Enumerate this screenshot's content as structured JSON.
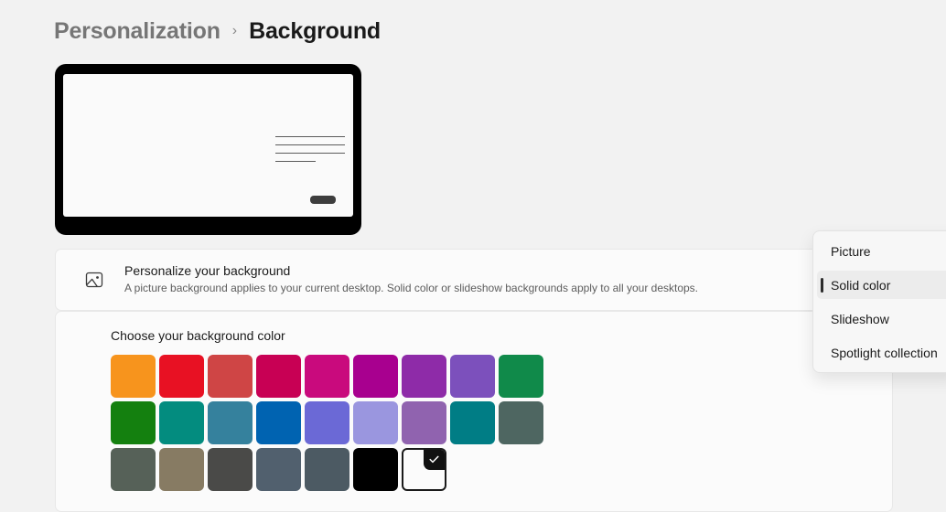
{
  "breadcrumb": {
    "parent": "Personalization",
    "separator": "›",
    "current": "Background"
  },
  "preview": {
    "icon": "monitor-preview",
    "screen_color": "#fafafa",
    "bezel_color": "#000000"
  },
  "personalize_card": {
    "icon": "picture-icon",
    "title": "Personalize your background",
    "subtitle": "A picture background applies to your current desktop. Solid color or slideshow backgrounds apply to all your desktops."
  },
  "colors_card": {
    "label": "Choose your background color",
    "swatches": [
      {
        "name": "orange",
        "hex": "#F7941D"
      },
      {
        "name": "red",
        "hex": "#E81123"
      },
      {
        "name": "muted-red",
        "hex": "#CF4545"
      },
      {
        "name": "crimson",
        "hex": "#C80054"
      },
      {
        "name": "magenta",
        "hex": "#C90A7D"
      },
      {
        "name": "purple-magenta",
        "hex": "#A8008F"
      },
      {
        "name": "purple",
        "hex": "#8E2BA8"
      },
      {
        "name": "light-purple",
        "hex": "#7C50BC"
      },
      {
        "name": "green",
        "hex": "#108A4A"
      },
      {
        "name": "dark-green",
        "hex": "#14800F"
      },
      {
        "name": "teal-green",
        "hex": "#038C7F"
      },
      {
        "name": "steel-blue",
        "hex": "#35819D"
      },
      {
        "name": "blue",
        "hex": "#0063B1"
      },
      {
        "name": "periwinkle",
        "hex": "#6B69D6"
      },
      {
        "name": "light-periwinkle",
        "hex": "#9A96DF"
      },
      {
        "name": "orchid",
        "hex": "#9063AF"
      },
      {
        "name": "teal",
        "hex": "#007D85"
      },
      {
        "name": "slate-green",
        "hex": "#4E6661"
      },
      {
        "name": "gray-green",
        "hex": "#566158"
      },
      {
        "name": "khaki",
        "hex": "#877B63"
      },
      {
        "name": "dark-gray",
        "hex": "#4A4A48"
      },
      {
        "name": "slate-blue-gray",
        "hex": "#51606E"
      },
      {
        "name": "dark-slate",
        "hex": "#4C5A63"
      },
      {
        "name": "black",
        "hex": "#000000"
      },
      {
        "name": "white",
        "hex": "#FBFBFB",
        "selected": true
      }
    ],
    "selected_badge_icon": "check-icon"
  },
  "dropdown": {
    "items": [
      {
        "label": "Picture",
        "selected": false
      },
      {
        "label": "Solid color",
        "selected": true
      },
      {
        "label": "Slideshow",
        "selected": false
      },
      {
        "label": "Spotlight collection",
        "selected": false
      }
    ]
  }
}
